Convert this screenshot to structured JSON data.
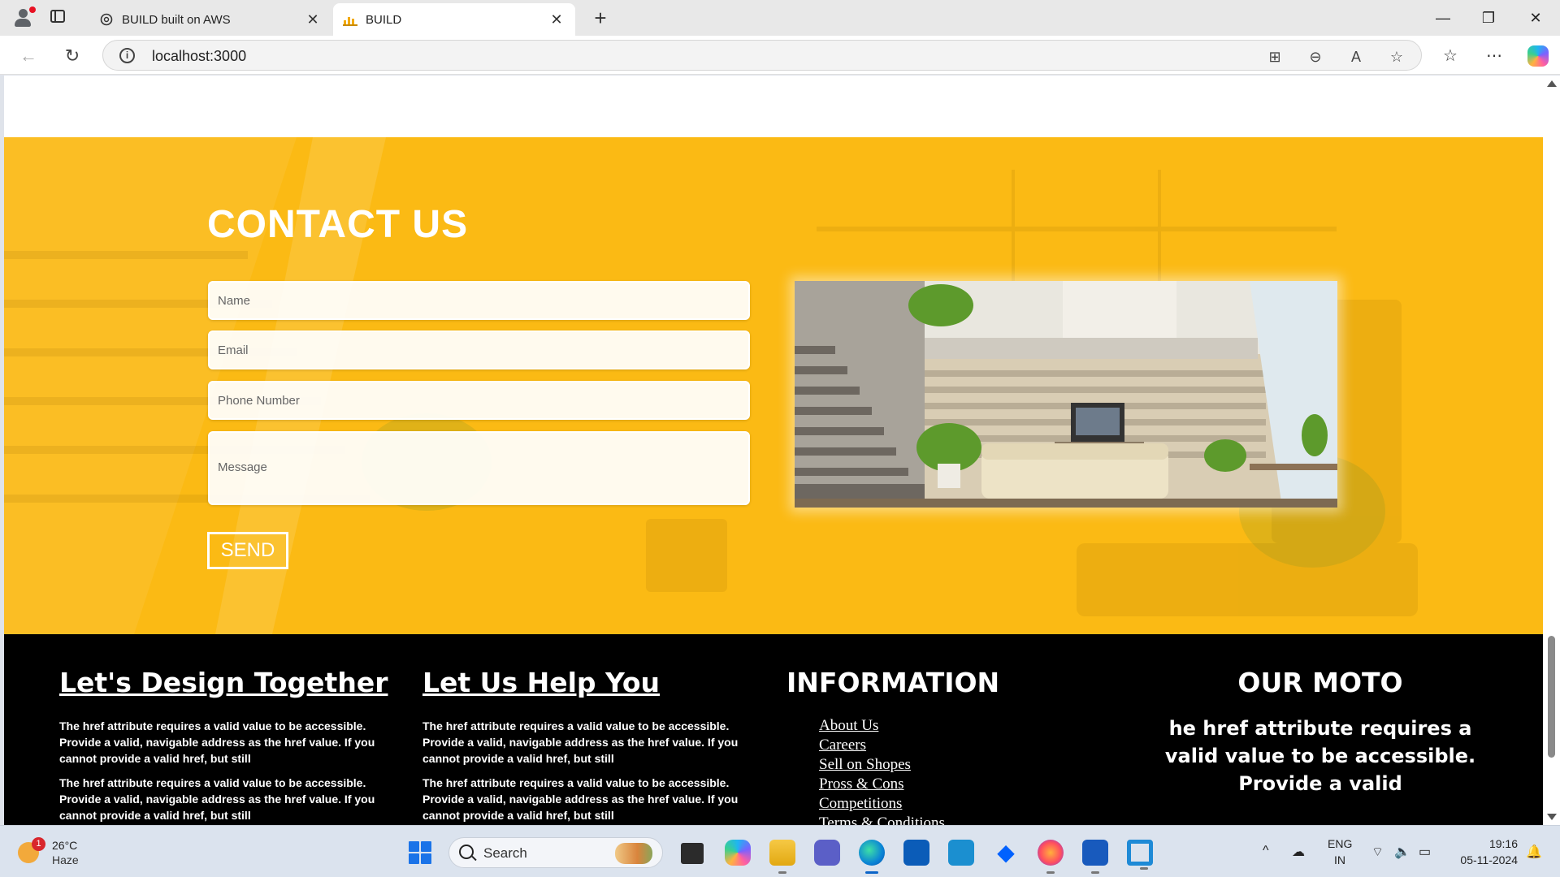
{
  "browser": {
    "tabs": [
      {
        "title": "BUILD built on AWS",
        "favicon": "openai-icon"
      },
      {
        "title": "BUILD",
        "favicon": "chart-icon"
      }
    ],
    "address": "localhost:3000"
  },
  "contact": {
    "title": "CONTACT US",
    "placeholders": {
      "name": "Name",
      "email": "Email",
      "phone": "Phone Number",
      "message": "Message"
    },
    "send_label": "SEND"
  },
  "footer": {
    "col1": {
      "heading": "Let's Design Together",
      "paragraphs": [
        "The href attribute requires a valid value to be accessible. Provide a valid, navigable address as the href value. If you cannot provide a valid href, but still",
        "The href attribute requires a valid value to be accessible. Provide a valid, navigable address as the href value. If you cannot provide a valid href, but still"
      ]
    },
    "col2": {
      "heading": "Let Us Help You",
      "paragraphs": [
        "The href attribute requires a valid value to be accessible. Provide a valid, navigable address as the href value. If you cannot provide a valid href, but still",
        "The href attribute requires a valid value to be accessible. Provide a valid, navigable address as the href value. If you cannot provide a valid href, but still"
      ]
    },
    "info": {
      "heading": "INFORMATION",
      "links": [
        "About Us",
        "Careers",
        "Sell on Shopes",
        "Pross & Cons",
        "Competitions",
        "Terms & Conditions"
      ]
    },
    "moto": {
      "heading": "OUR MOTO",
      "text": "he href attribute requires a valid value to be accessible. Provide a valid"
    }
  },
  "taskbar": {
    "weather": {
      "badge": "1",
      "temp": "26°C",
      "condition": "Haze"
    },
    "search_label": "Search",
    "language": "ENG",
    "region": "IN",
    "time": "19:16",
    "date": "05-11-2024"
  }
}
